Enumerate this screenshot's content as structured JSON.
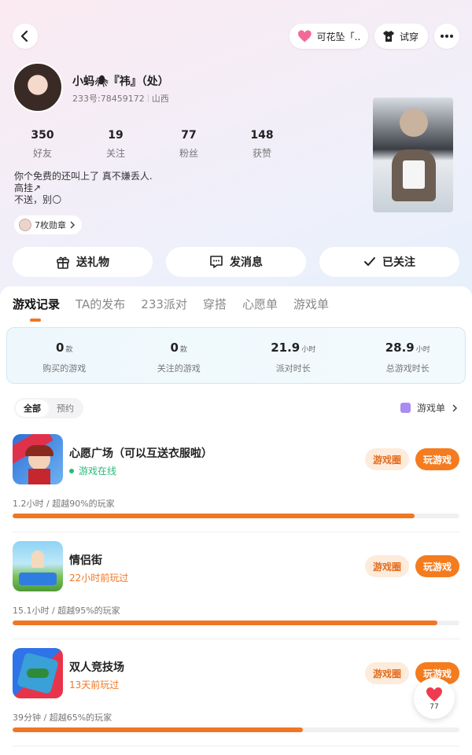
{
  "header": {
    "back_icon": "chevron-left-icon",
    "pendant_label": "可花坠「...",
    "tryon_label": "试穿",
    "more_icon": "more-horizontal-icon"
  },
  "profile": {
    "name": "小蚂🕷『祎』（处）",
    "id_text": "233号:78459172",
    "region": "山西",
    "stats": [
      {
        "value": "350",
        "label": "好友"
      },
      {
        "value": "19",
        "label": "关注"
      },
      {
        "value": "77",
        "label": "粉丝"
      },
      {
        "value": "148",
        "label": "获赞"
      }
    ],
    "bio": [
      "你个免费的还叫上了 真不嫌丢人.",
      "高挂↗",
      "不送，别🌕"
    ],
    "badge_text": "7枚勋章"
  },
  "actions": {
    "gift": "送礼物",
    "message": "发消息",
    "followed": "已关注"
  },
  "tabs": [
    "游戏记录",
    "TA的发布",
    "233派对",
    "穿搭",
    "心愿单",
    "游戏单"
  ],
  "summary": [
    {
      "value": "0",
      "unit": "款",
      "label": "购买的游戏"
    },
    {
      "value": "0",
      "unit": "款",
      "label": "关注的游戏"
    },
    {
      "value": "21.9",
      "unit": "小时",
      "label": "派对时长"
    },
    {
      "value": "28.9",
      "unit": "小时",
      "label": "总游戏时长"
    }
  ],
  "filter": {
    "all": "全部",
    "reserve": "预约"
  },
  "gamelist_link": "游戏单",
  "game_buttons": {
    "circle": "游戏圈",
    "play": "玩游戏"
  },
  "games": [
    {
      "title": "心愿广场（可以互送衣服啦）",
      "status": "游戏在线",
      "online": true,
      "stat": "1.2小时 / 超越90%的玩家",
      "percent": 90
    },
    {
      "title": "情侣街",
      "status": "22小时前玩过",
      "online": false,
      "stat": "15.1小时 / 超越95%的玩家",
      "percent": 95
    },
    {
      "title": "双人竞技场",
      "status": "13天前玩过",
      "online": false,
      "stat": "39分钟 / 超越65%的玩家",
      "percent": 65
    }
  ],
  "like_count": "77",
  "colors": {
    "accent": "#f07623",
    "online": "#2bb87a"
  }
}
